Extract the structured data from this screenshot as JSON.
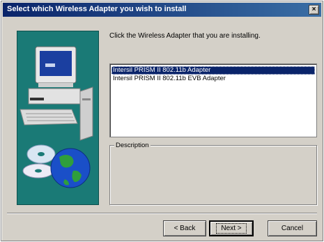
{
  "window": {
    "title": "Select which Wireless Adapter you wish to install",
    "close_glyph": "×"
  },
  "main": {
    "instruction": "Click the Wireless Adapter that you are installing.",
    "adapters": [
      {
        "label": "Intersil PRISM II 802.11b Adapter",
        "selected": true
      },
      {
        "label": "Intersil PRISM II 802.11b EVB Adapter",
        "selected": false
      }
    ],
    "description_label": "Description",
    "description_text": ""
  },
  "buttons": {
    "back_label": "< Back",
    "next_label": "Next >",
    "cancel_label": "Cancel"
  },
  "colors": {
    "title_bar": "#0a246a",
    "panel_teal": "#1a7a76",
    "selection": "#0a246a",
    "dialog_face": "#d4d0c8"
  },
  "icons": {
    "art": "computer-with-cd-and-globe",
    "close": "close-icon"
  }
}
